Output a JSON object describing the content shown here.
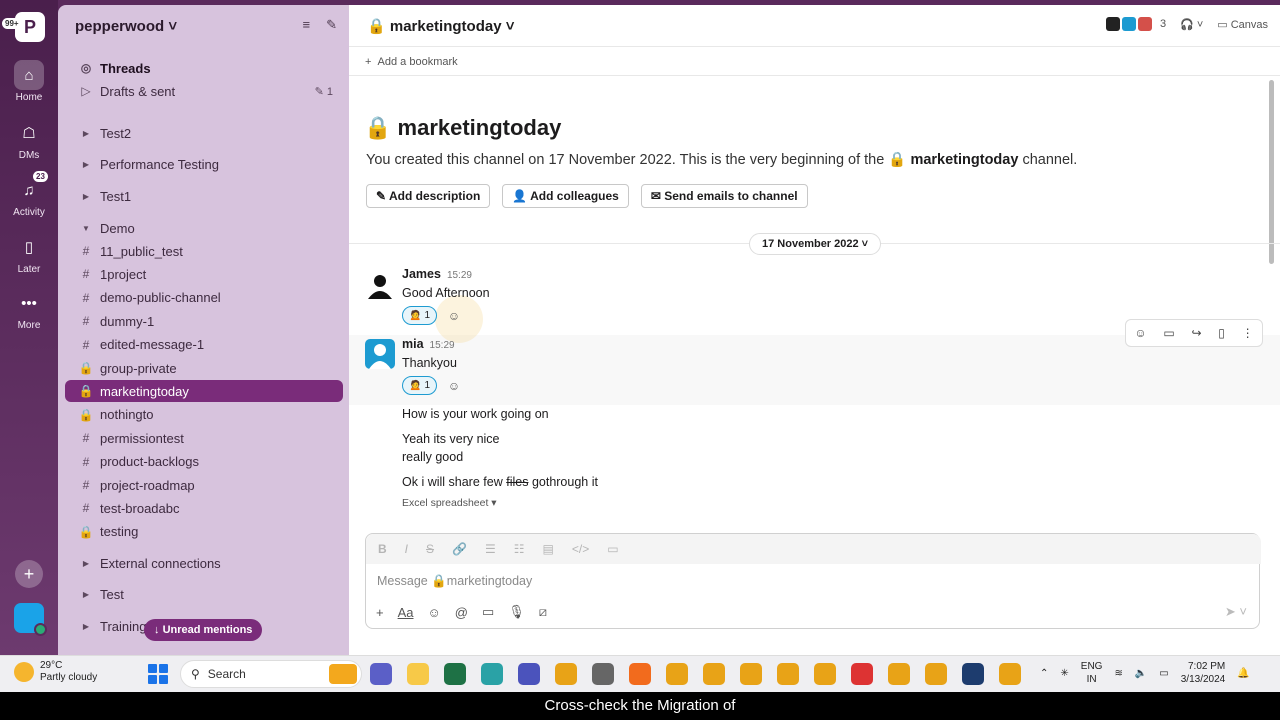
{
  "colors": {
    "rail": "#4a1f4c",
    "sidebar": "#d7c3dd",
    "active_item": "#7a2c7a",
    "accent": "#1d9bd1"
  },
  "rail": {
    "workspace_badge": "99+",
    "workspace_initial": "P",
    "items": [
      {
        "label": "Home",
        "icon": "home-icon"
      },
      {
        "label": "DMs",
        "icon": "dm-icon"
      },
      {
        "label": "Activity",
        "icon": "bell-icon",
        "badge": "23"
      },
      {
        "label": "Later",
        "icon": "bookmark-icon"
      },
      {
        "label": "More",
        "icon": "more-icon"
      }
    ]
  },
  "sidebar": {
    "workspace": "pepperwood",
    "threads": "Threads",
    "drafts": "Drafts & sent",
    "drafts_count": "1",
    "sections": [
      "Test2",
      "Performance Testing",
      "Test1"
    ],
    "demo_section": "Demo",
    "channels": [
      {
        "name": "11_public_test",
        "type": "public"
      },
      {
        "name": "1project",
        "type": "public"
      },
      {
        "name": "demo-public-channel",
        "type": "public"
      },
      {
        "name": "dummy-1",
        "type": "public"
      },
      {
        "name": "edited-message-1",
        "type": "public"
      },
      {
        "name": "group-private",
        "type": "private"
      },
      {
        "name": "marketingtoday",
        "type": "private",
        "active": true
      },
      {
        "name": "nothingto",
        "type": "private"
      },
      {
        "name": "permissiontest",
        "type": "public"
      },
      {
        "name": "product-backlogs",
        "type": "public"
      },
      {
        "name": "project-roadmap",
        "type": "public"
      },
      {
        "name": "test-broadabc",
        "type": "public"
      },
      {
        "name": "testing",
        "type": "private"
      }
    ],
    "bottom_sections": [
      "External connections",
      "Test",
      "Training"
    ],
    "unread_mentions": "Unread mentions"
  },
  "header": {
    "channel": "marketingtoday",
    "member_count": "3",
    "canvas": "Canvas",
    "add_bookmark": "Add a bookmark"
  },
  "intro": {
    "title": "marketingtoday",
    "text_before": "You created this channel on 17 November 2022. This is the very beginning of the",
    "channel": "marketingtoday",
    "text_after": "channel.",
    "buttons": [
      "Add description",
      "Add colleagues",
      "Send emails to channel"
    ]
  },
  "date_divider": "17 November 2022",
  "messages": [
    {
      "author": "James",
      "time": "15:29",
      "text": "Good Afternoon",
      "reaction_count": "1"
    },
    {
      "author": "mia",
      "time": "15:29",
      "text": "Thankyou",
      "reaction_count": "1"
    }
  ],
  "followups": {
    "line1": "How is your work going on",
    "line2": "Yeah its very nice",
    "line3": "really good",
    "line4_before": "Ok i will share few",
    "line4_strike": "files",
    "line4_after": "gothrough it",
    "attachment": "Excel spreadsheet"
  },
  "composer": {
    "placeholder": "Message",
    "channel": "marketingtoday",
    "format_label": "Aa"
  },
  "taskbar": {
    "temperature": "29°C",
    "weather": "Partly cloudy",
    "search": "Search",
    "lang_top": "ENG",
    "lang_bottom": "IN",
    "time": "7:02 PM",
    "date": "3/13/2024"
  },
  "caption": "Cross-check the Migration of"
}
